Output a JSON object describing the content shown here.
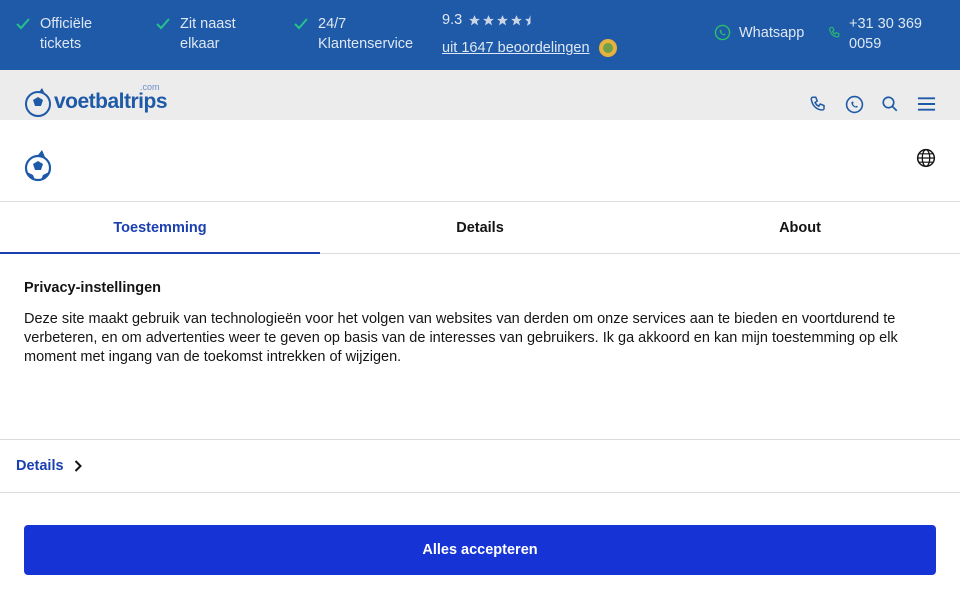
{
  "topbar": {
    "usps": [
      {
        "line1": "Officiële",
        "line2": "tickets"
      },
      {
        "line1": "Zit naast",
        "line2": "elkaar"
      },
      {
        "line1": "24/7",
        "line2": "Klantenservice"
      }
    ],
    "rating": {
      "score": "9.3",
      "stars": 4.5,
      "reviews_link": "uit 1647 beoordelingen"
    },
    "whatsapp_label": "Whatsapp",
    "phone": {
      "line1": "+31 30 369",
      "line2": "0059"
    }
  },
  "header": {
    "logo_text": "voetbaltrips",
    "logo_suffix": ".com"
  },
  "modal": {
    "tabs": [
      {
        "label": "Toestemming",
        "active": true
      },
      {
        "label": "Details",
        "active": false
      },
      {
        "label": "About",
        "active": false
      }
    ],
    "title": "Privacy-instellingen",
    "body": "Deze site maakt gebruik van technologieën voor het volgen van websites van derden om onze services aan te bieden en voortdurend te verbeteren, en om advertenties weer te geven op basis van de interesses van gebruikers. Ik ga akkoord en kan mijn toestemming op elk moment met ingang van de toekomst intrekken of wijzigen.",
    "details_link": "Details",
    "accept_label": "Alles accepteren"
  },
  "colors": {
    "topbar_bg": "#1e5aa8",
    "accent": "#1a3fb0",
    "button": "#1633d6",
    "whatsapp": "#25d366"
  }
}
